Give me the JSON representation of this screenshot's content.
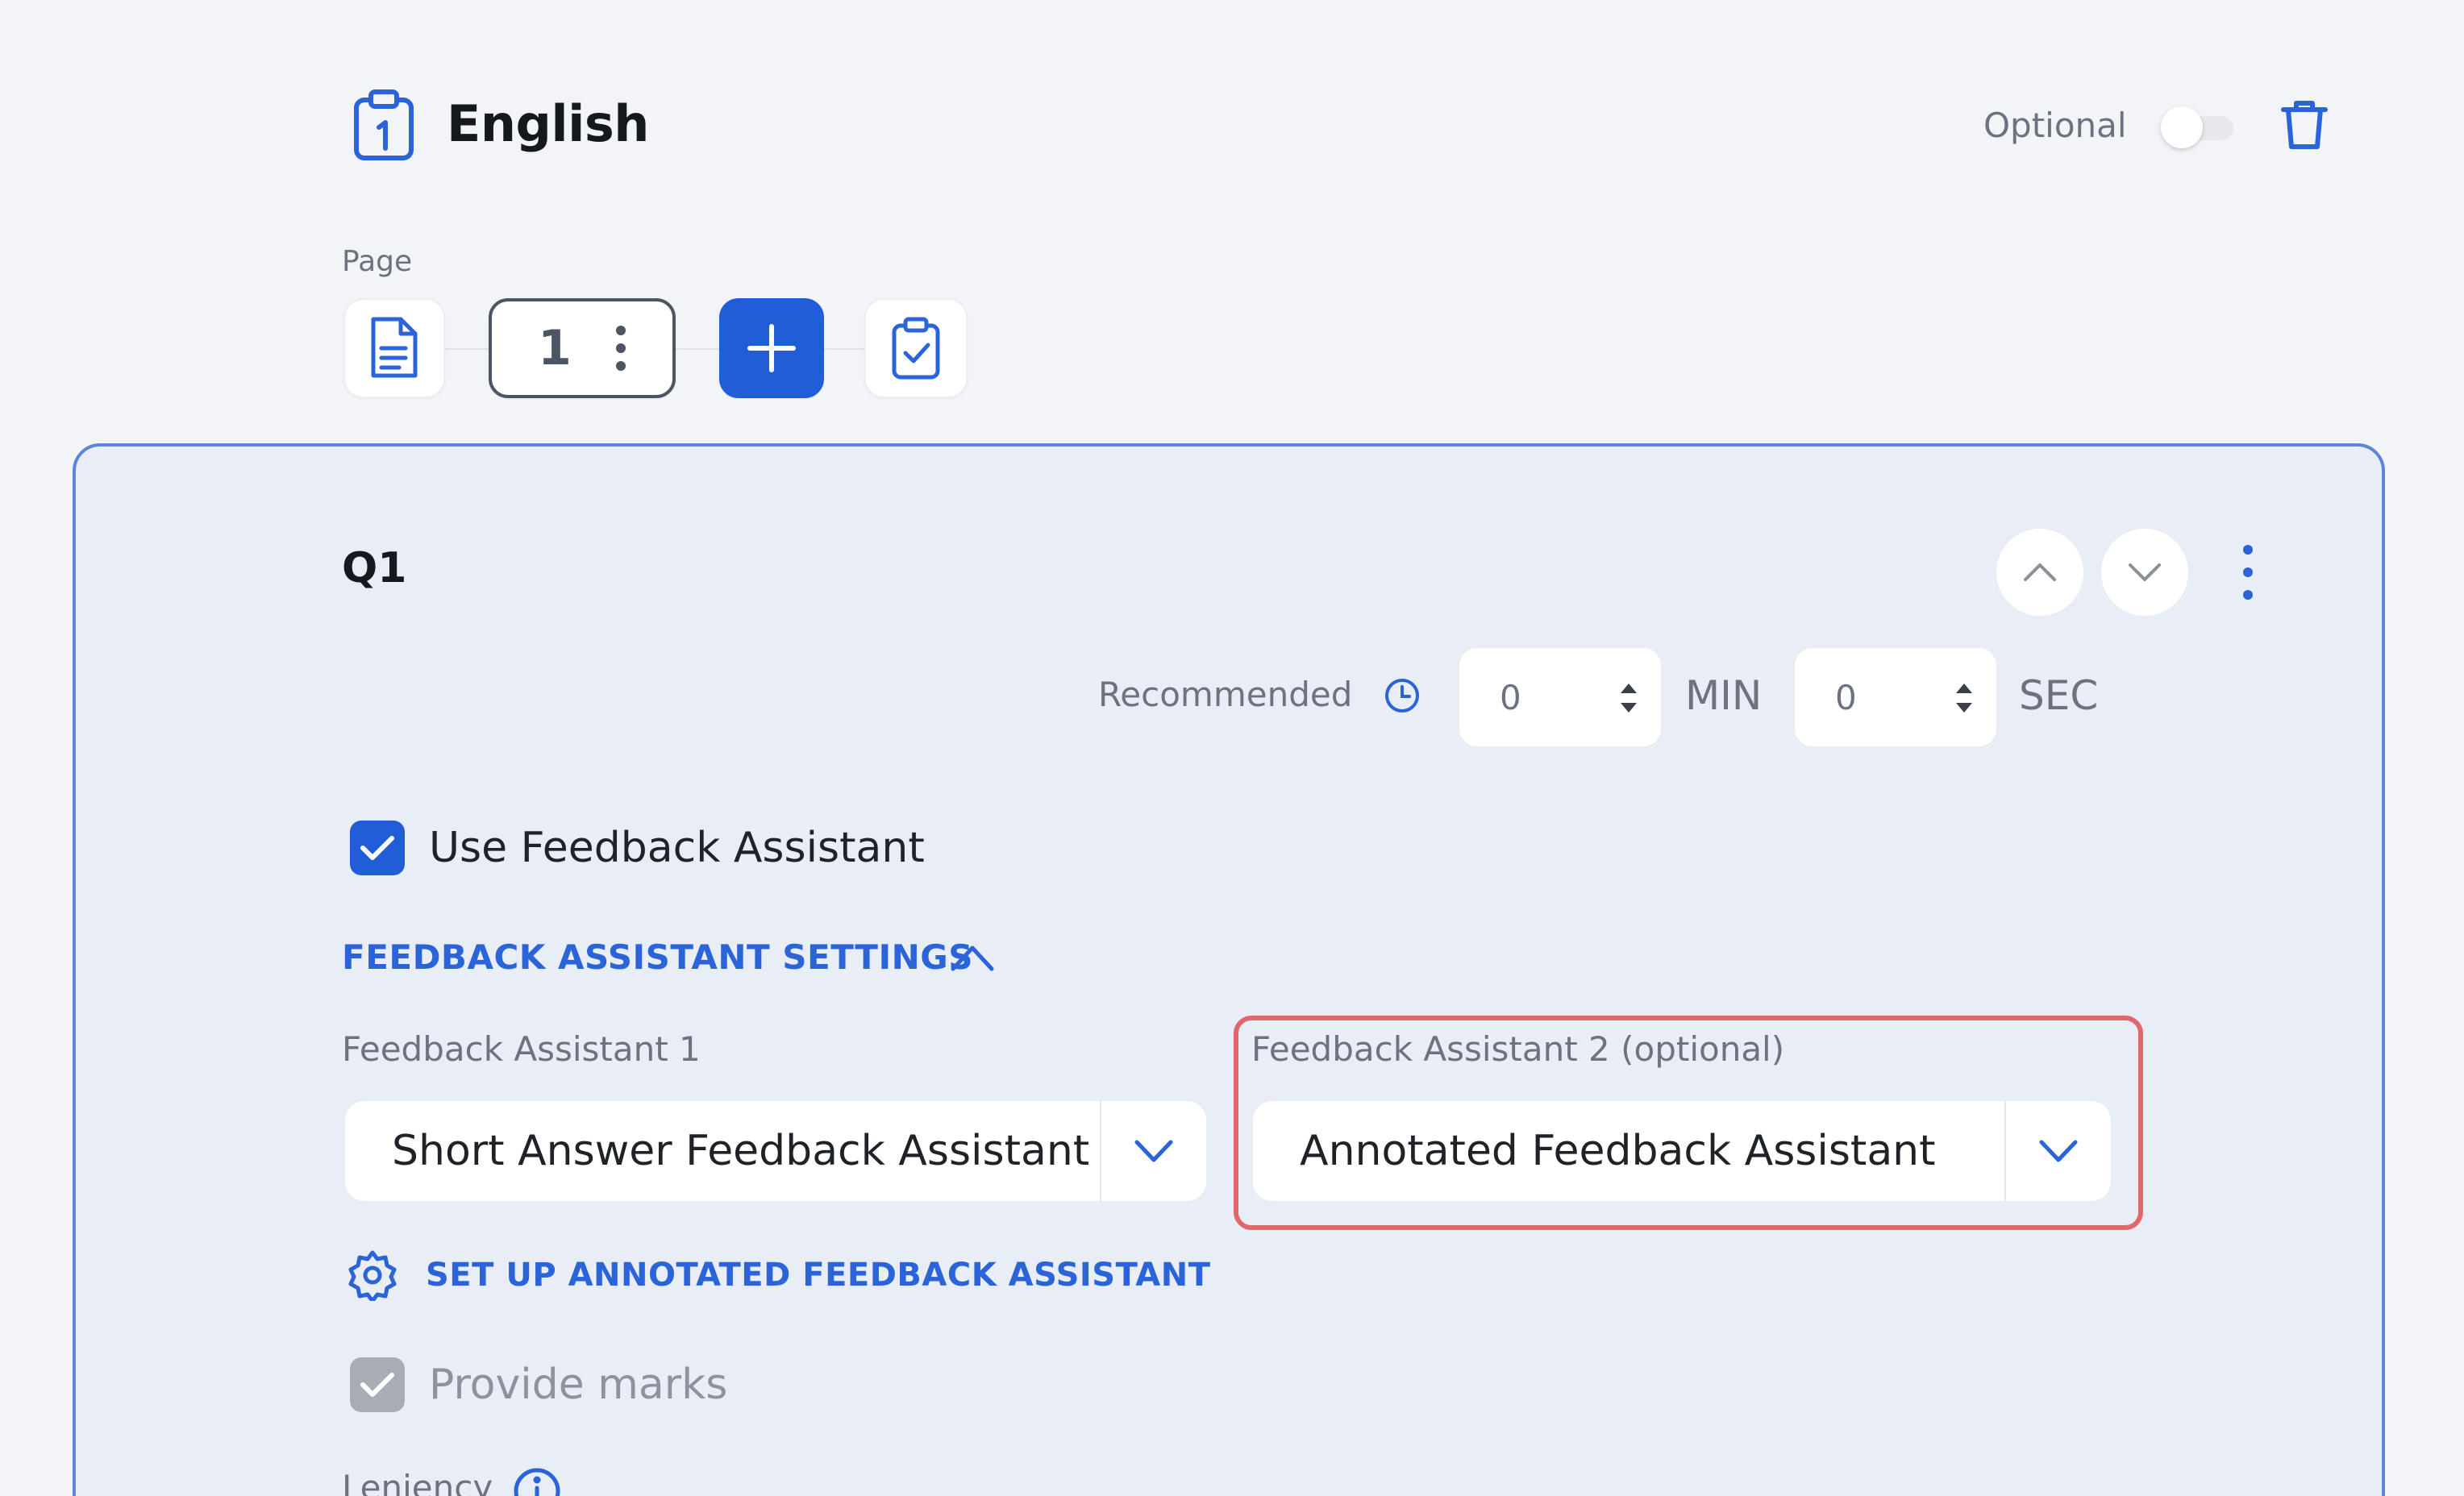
{
  "header": {
    "title": "English",
    "optional_label": "Optional"
  },
  "pages": {
    "label": "Page",
    "current_page": "1"
  },
  "question": {
    "label": "Q1",
    "recommended_label": "Recommended",
    "minutes": "0",
    "min_unit": "MIN",
    "seconds": "0",
    "sec_unit": "SEC",
    "use_feedback_label": "Use Feedback Assistant",
    "settings_heading": "FEEDBACK ASSISTANT SETTINGS",
    "fa1_label": "Feedback Assistant 1",
    "fa1_value": "Short Answer Feedback Assistant",
    "fa2_label": "Feedback Assistant 2 (optional)",
    "fa2_value": "Annotated Feedback Assistant",
    "setup_link": "SET UP ANNOTATED FEEDBACK ASSISTANT",
    "provide_marks_label": "Provide marks",
    "leniency_label": "Leniency"
  },
  "colors": {
    "accent": "#1f5ed6",
    "link": "#2a64d8",
    "highlight": "#e0676b",
    "card_bg": "#e8edf6"
  }
}
